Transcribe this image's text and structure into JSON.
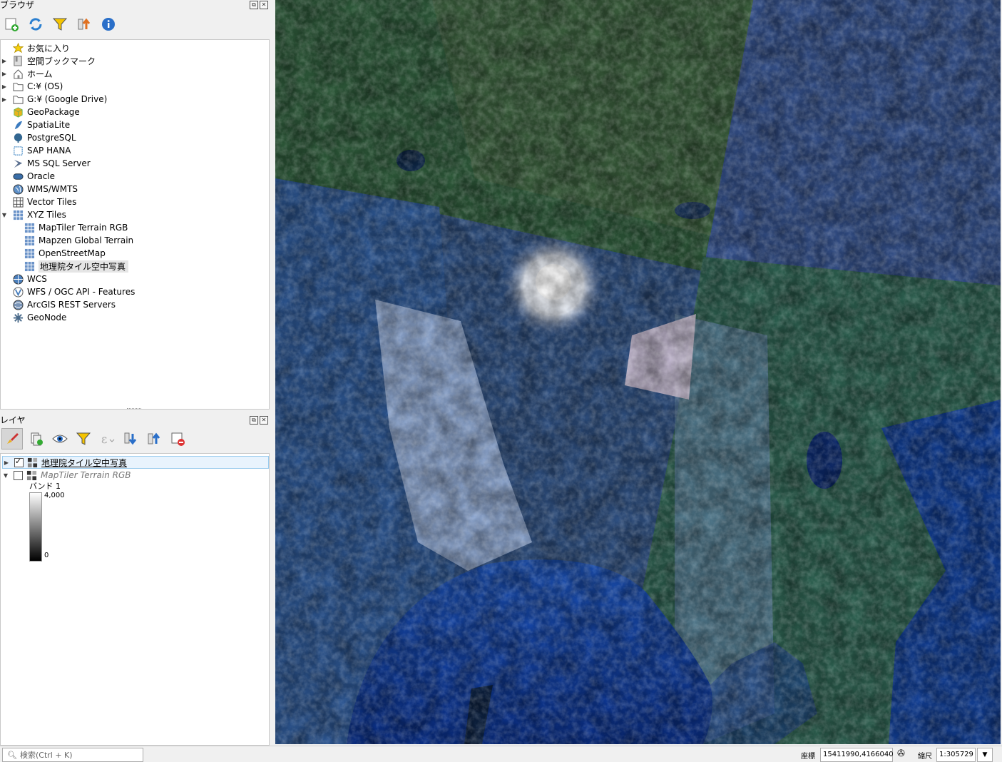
{
  "browser_panel": {
    "title": "ブラウザ",
    "items": [
      {
        "label": "お気に入り",
        "icon": "star-icon",
        "expand": ""
      },
      {
        "label": "空間ブックマーク",
        "icon": "bookmark-icon",
        "expand": "▶"
      },
      {
        "label": "ホーム",
        "icon": "home-icon",
        "expand": "▶"
      },
      {
        "label": "C:¥ (OS)",
        "icon": "folder-icon",
        "expand": "▶"
      },
      {
        "label": "G:¥ (Google Drive)",
        "icon": "folder-icon",
        "expand": "▶"
      },
      {
        "label": "GeoPackage",
        "icon": "geopackage-icon",
        "expand": ""
      },
      {
        "label": "SpatiaLite",
        "icon": "spatialite-icon",
        "expand": ""
      },
      {
        "label": "PostgreSQL",
        "icon": "postgresql-icon",
        "expand": ""
      },
      {
        "label": "SAP HANA",
        "icon": "saphana-icon",
        "expand": ""
      },
      {
        "label": "MS SQL Server",
        "icon": "mssql-icon",
        "expand": ""
      },
      {
        "label": "Oracle",
        "icon": "oracle-icon",
        "expand": ""
      },
      {
        "label": "WMS/WMTS",
        "icon": "wms-globe-icon",
        "expand": ""
      },
      {
        "label": "Vector Tiles",
        "icon": "vector-tiles-icon",
        "expand": ""
      },
      {
        "label": "XYZ Tiles",
        "icon": "xyz-tiles-icon",
        "expand": "▼"
      },
      {
        "label": "MapTiler Terrain RGB",
        "icon": "xyz-tiles-icon",
        "expand": "",
        "child": true
      },
      {
        "label": "Mapzen Global Terrain",
        "icon": "xyz-tiles-icon",
        "expand": "",
        "child": true
      },
      {
        "label": "OpenStreetMap",
        "icon": "xyz-tiles-icon",
        "expand": "",
        "child": true
      },
      {
        "label": "地理院タイル空中写真",
        "icon": "xyz-tiles-icon",
        "expand": "",
        "child": true,
        "selected": true
      },
      {
        "label": "WCS",
        "icon": "wcs-globe-icon",
        "expand": ""
      },
      {
        "label": "WFS / OGC API - Features",
        "icon": "wfs-globe-icon",
        "expand": ""
      },
      {
        "label": "ArcGIS REST Servers",
        "icon": "arcgis-icon",
        "expand": ""
      },
      {
        "label": "GeoNode",
        "icon": "geonode-icon",
        "expand": ""
      }
    ]
  },
  "layers_panel": {
    "title": "レイヤ",
    "layers": [
      {
        "name": "地理院タイル空中写真",
        "checked": true,
        "expand": "▶"
      },
      {
        "name": "MapTiler Terrain RGB",
        "checked": false,
        "expand": "▼"
      }
    ],
    "legend": {
      "band_label": "バンド 1",
      "max": "4,000",
      "min": "0"
    }
  },
  "statusbar": {
    "search_placeholder": "検索(Ctrl + K)",
    "coord_label": "座標",
    "coord_value": "15411990,4166040",
    "scale_label": "縮尺",
    "scale_value": "1:305729"
  },
  "colors": {
    "selection": "#cce8ff",
    "ocean": "#0c3a8a"
  }
}
